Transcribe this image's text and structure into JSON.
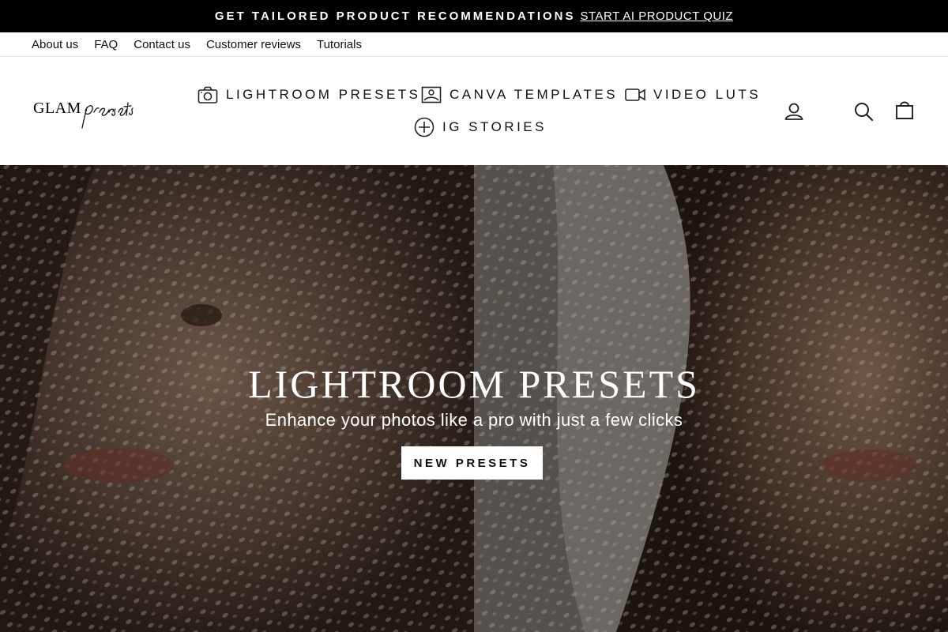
{
  "announcement": {
    "text": "GET TAILORED PRODUCT RECOMMENDATIONS",
    "link": "START AI PRODUCT QUIZ"
  },
  "utility_nav": [
    "About us",
    "FAQ",
    "Contact us",
    "Customer reviews",
    "Tutorials"
  ],
  "logo": {
    "text_1": "GLAM",
    "text_2": "presets"
  },
  "main_nav": [
    {
      "label": "LIGHTROOM PRESETS",
      "icon": "camera-icon"
    },
    {
      "label": "CANVA TEMPLATES",
      "icon": "image-icon"
    },
    {
      "label": "VIDEO LUTS",
      "icon": "video-camera-icon"
    },
    {
      "label": "IG STORIES",
      "icon": "plus-circle-icon"
    }
  ],
  "header_icons": [
    "account-icon",
    "search-icon",
    "cart-icon"
  ],
  "hero": {
    "title": "LIGHTROOM PRESETS",
    "subtitle": "Enhance your photos like a pro with just a few clicks",
    "button": "NEW PRESETS"
  },
  "colors": {
    "announcement_bg": "#000000",
    "hero_overlay": "#3a2a22"
  }
}
